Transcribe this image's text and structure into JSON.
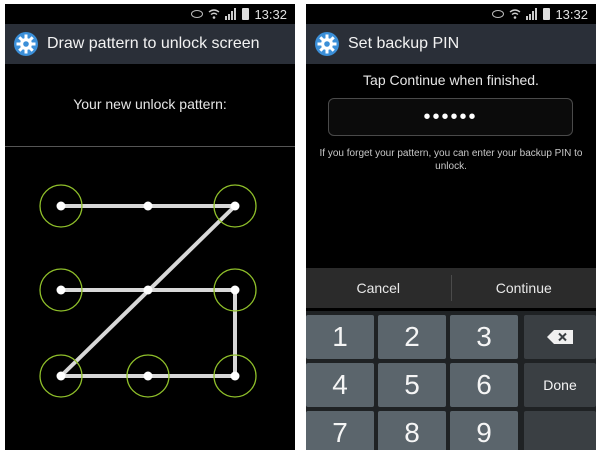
{
  "left_screen": {
    "status_time": "13:32",
    "title": "Draw pattern to unlock screen",
    "prompt": "Your new unlock pattern:",
    "pattern_dots": 9,
    "pattern_selected_nodes": [
      1,
      3,
      7,
      8,
      9,
      6,
      4
    ],
    "pattern_line_color": "#d8d8d8",
    "pattern_ring_color": "#8fbf2a"
  },
  "right_screen": {
    "status_time": "13:32",
    "title": "Set backup PIN",
    "prompt": "Tap Continue when finished.",
    "pin_mask": "••••••",
    "hint": "If you forget your pattern, you can enter your backup PIN to unlock.",
    "cancel_label": "Cancel",
    "continue_label": "Continue",
    "keys": {
      "k1": "1",
      "k2": "2",
      "k3": "3",
      "k4": "4",
      "k5": "5",
      "k6": "6",
      "k7": "7",
      "k8": "8",
      "k9": "9",
      "done": "Done"
    }
  },
  "icons": {
    "settings": "gear-icon",
    "backspace": "backspace-icon",
    "wifi": "wifi-icon",
    "signal": "signal-icon",
    "battery": "battery-icon",
    "eye": "eye-icon"
  },
  "colors": {
    "title_bar": "#2a2f38",
    "keypad_key": "#5b656c",
    "gear": "#3b8fd8"
  }
}
